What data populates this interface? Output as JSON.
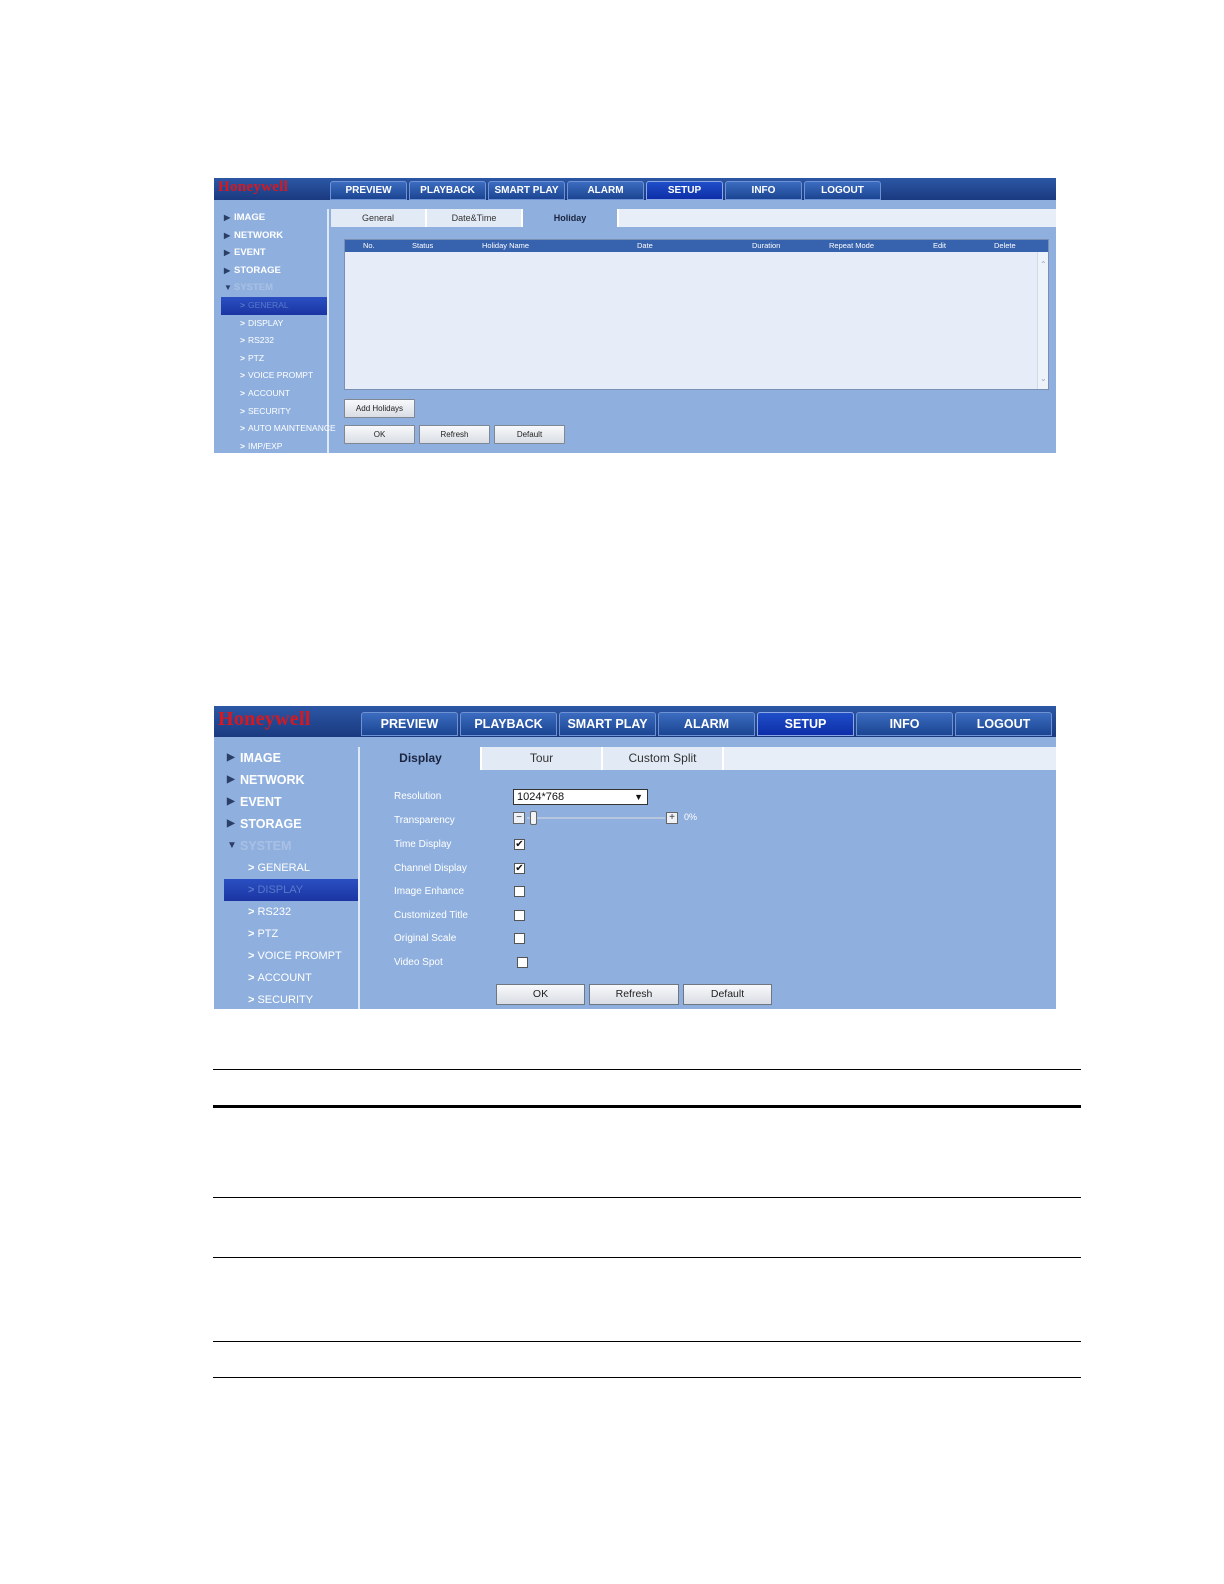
{
  "brand": "Honeywell",
  "nav": [
    "PREVIEW",
    "PLAYBACK",
    "SMART PLAY",
    "ALARM",
    "SETUP",
    "INFO",
    "LOGOUT"
  ],
  "nav_active": "SETUP",
  "colors": {
    "header": "#1a3a80",
    "panel": "#8fb0de",
    "logo": "#d8181f",
    "selected": "#1b35a2"
  },
  "screen1": {
    "sidebar": [
      {
        "label": "IMAGE",
        "type": "group"
      },
      {
        "label": "NETWORK",
        "type": "group"
      },
      {
        "label": "EVENT",
        "type": "group"
      },
      {
        "label": "STORAGE",
        "type": "group"
      },
      {
        "label": "SYSTEM",
        "type": "open"
      },
      {
        "label": "GENERAL",
        "type": "selected"
      },
      {
        "label": "DISPLAY",
        "type": "sub"
      },
      {
        "label": "RS232",
        "type": "sub"
      },
      {
        "label": "PTZ",
        "type": "sub"
      },
      {
        "label": "VOICE PROMPT",
        "type": "sub"
      },
      {
        "label": "ACCOUNT",
        "type": "sub"
      },
      {
        "label": "SECURITY",
        "type": "sub"
      },
      {
        "label": "AUTO MAINTENANCE",
        "type": "sub"
      },
      {
        "label": "IMP/EXP",
        "type": "sub"
      }
    ],
    "tabs": [
      "General",
      "Date&Time",
      "Holiday"
    ],
    "tab_active": "Holiday",
    "table_headers": [
      "No.",
      "Status",
      "Holiday Name",
      "Date",
      "Duration",
      "Repeat Mode",
      "Edit",
      "Delete"
    ],
    "add_button": "Add Holidays",
    "buttons": [
      "OK",
      "Refresh",
      "Default"
    ]
  },
  "screen2": {
    "sidebar": [
      {
        "label": "IMAGE",
        "type": "group"
      },
      {
        "label": "NETWORK",
        "type": "group"
      },
      {
        "label": "EVENT",
        "type": "group"
      },
      {
        "label": "STORAGE",
        "type": "group"
      },
      {
        "label": "SYSTEM",
        "type": "open"
      },
      {
        "label": "GENERAL",
        "type": "sub"
      },
      {
        "label": "DISPLAY",
        "type": "selected"
      },
      {
        "label": "RS232",
        "type": "sub"
      },
      {
        "label": "PTZ",
        "type": "sub"
      },
      {
        "label": "VOICE PROMPT",
        "type": "sub"
      },
      {
        "label": "ACCOUNT",
        "type": "sub"
      },
      {
        "label": "SECURITY",
        "type": "sub"
      }
    ],
    "tabs": [
      "Display",
      "Tour",
      "Custom Split"
    ],
    "tab_active": "Display",
    "resolution_label": "Resolution",
    "resolution_value": "1024*768",
    "transparency_label": "Transparency",
    "transparency_value": "0%",
    "transparency_fraction": 0,
    "checks": [
      {
        "label": "Time Display",
        "checked": true
      },
      {
        "label": "Channel Display",
        "checked": true
      },
      {
        "label": "Image Enhance",
        "checked": false
      },
      {
        "label": "Customized Title",
        "checked": false
      },
      {
        "label": "Original Scale",
        "checked": false
      },
      {
        "label": "Video Spot",
        "checked": false
      }
    ],
    "buttons": [
      "OK",
      "Refresh",
      "Default"
    ]
  }
}
